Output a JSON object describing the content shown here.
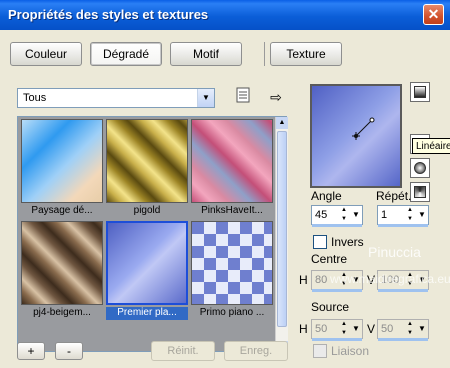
{
  "window": {
    "title": "Propriétés des styles et textures",
    "close_icon": "close-icon"
  },
  "tabs": [
    {
      "label": "Couleur"
    },
    {
      "label": "Dégradé"
    },
    {
      "label": "Motif"
    },
    {
      "label": "Texture"
    }
  ],
  "category": {
    "value": "Tous"
  },
  "gradients": [
    {
      "label": "Paysage dé..."
    },
    {
      "label": "pigold"
    },
    {
      "label": "PinksHaveIt..."
    },
    {
      "label": "pj4-beigem..."
    },
    {
      "label": "Premier pla..."
    },
    {
      "label": "Primo piano ..."
    }
  ],
  "buttons": {
    "add": "+",
    "remove": "-",
    "reset": "Réinit.",
    "save": "Enreg."
  },
  "tooltip": "Linéaire",
  "angle": {
    "label": "Angle",
    "value": "45"
  },
  "repeat": {
    "label": "Répét.",
    "value": "1"
  },
  "invert": {
    "label": "Invers"
  },
  "centre": {
    "label": "Centre",
    "h_label": "H",
    "h_value": "80",
    "v_label": "V",
    "v_value": "100"
  },
  "source": {
    "label": "Source",
    "h_label": "H",
    "h_value": "50",
    "v_label": "V",
    "v_value": "50"
  },
  "link": {
    "label": "Liaison"
  },
  "watermark": {
    "line1": "Pinuccia",
    "line2": "www.maidiregrafica.eu"
  }
}
